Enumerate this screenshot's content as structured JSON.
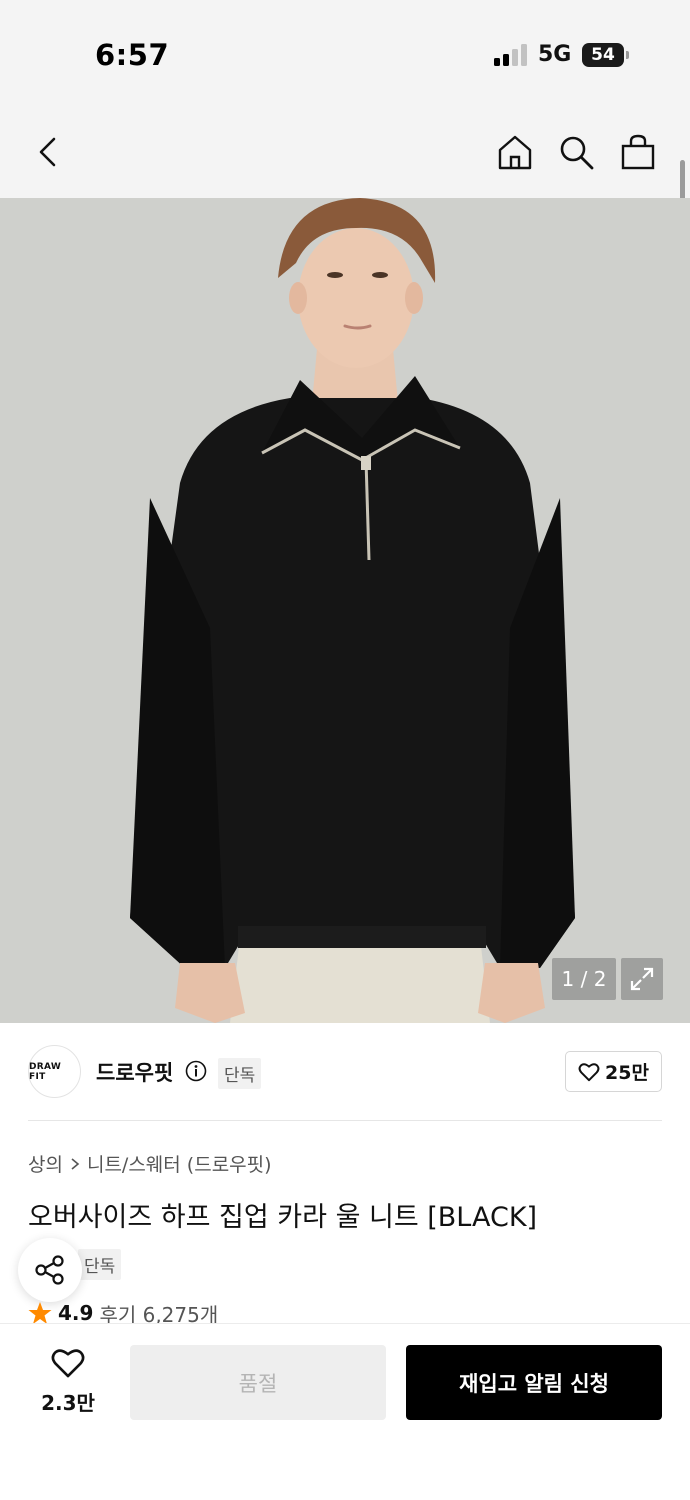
{
  "status_bar": {
    "time": "6:57",
    "network": "5G",
    "battery": "54"
  },
  "nav": {
    "icons": [
      "back-icon",
      "home-icon",
      "search-icon",
      "shopping-bag-icon"
    ]
  },
  "gallery": {
    "pager": "1 / 2",
    "expand_icon": "expand-icon"
  },
  "brand": {
    "logo_text": "DRAW FIT",
    "name": "드로우핏",
    "badge": "단독",
    "like_count": "25만"
  },
  "product": {
    "breadcrumb": [
      "상의",
      "니트/스웨터 (드로우핏)"
    ],
    "title": "오버사이즈 하프 집업 카라 울 니트 [BLACK]",
    "badge": "단독",
    "rating": "4.9",
    "reviews": "후기 6,275개"
  },
  "bottom_bar": {
    "wish_count": "2.3만",
    "soldout_label": "품절",
    "restock_label": "재입고 알림 신청"
  },
  "colors": {
    "accent": "#000000",
    "star": "#ff8a00",
    "disabled_bg": "#eeeeee"
  }
}
